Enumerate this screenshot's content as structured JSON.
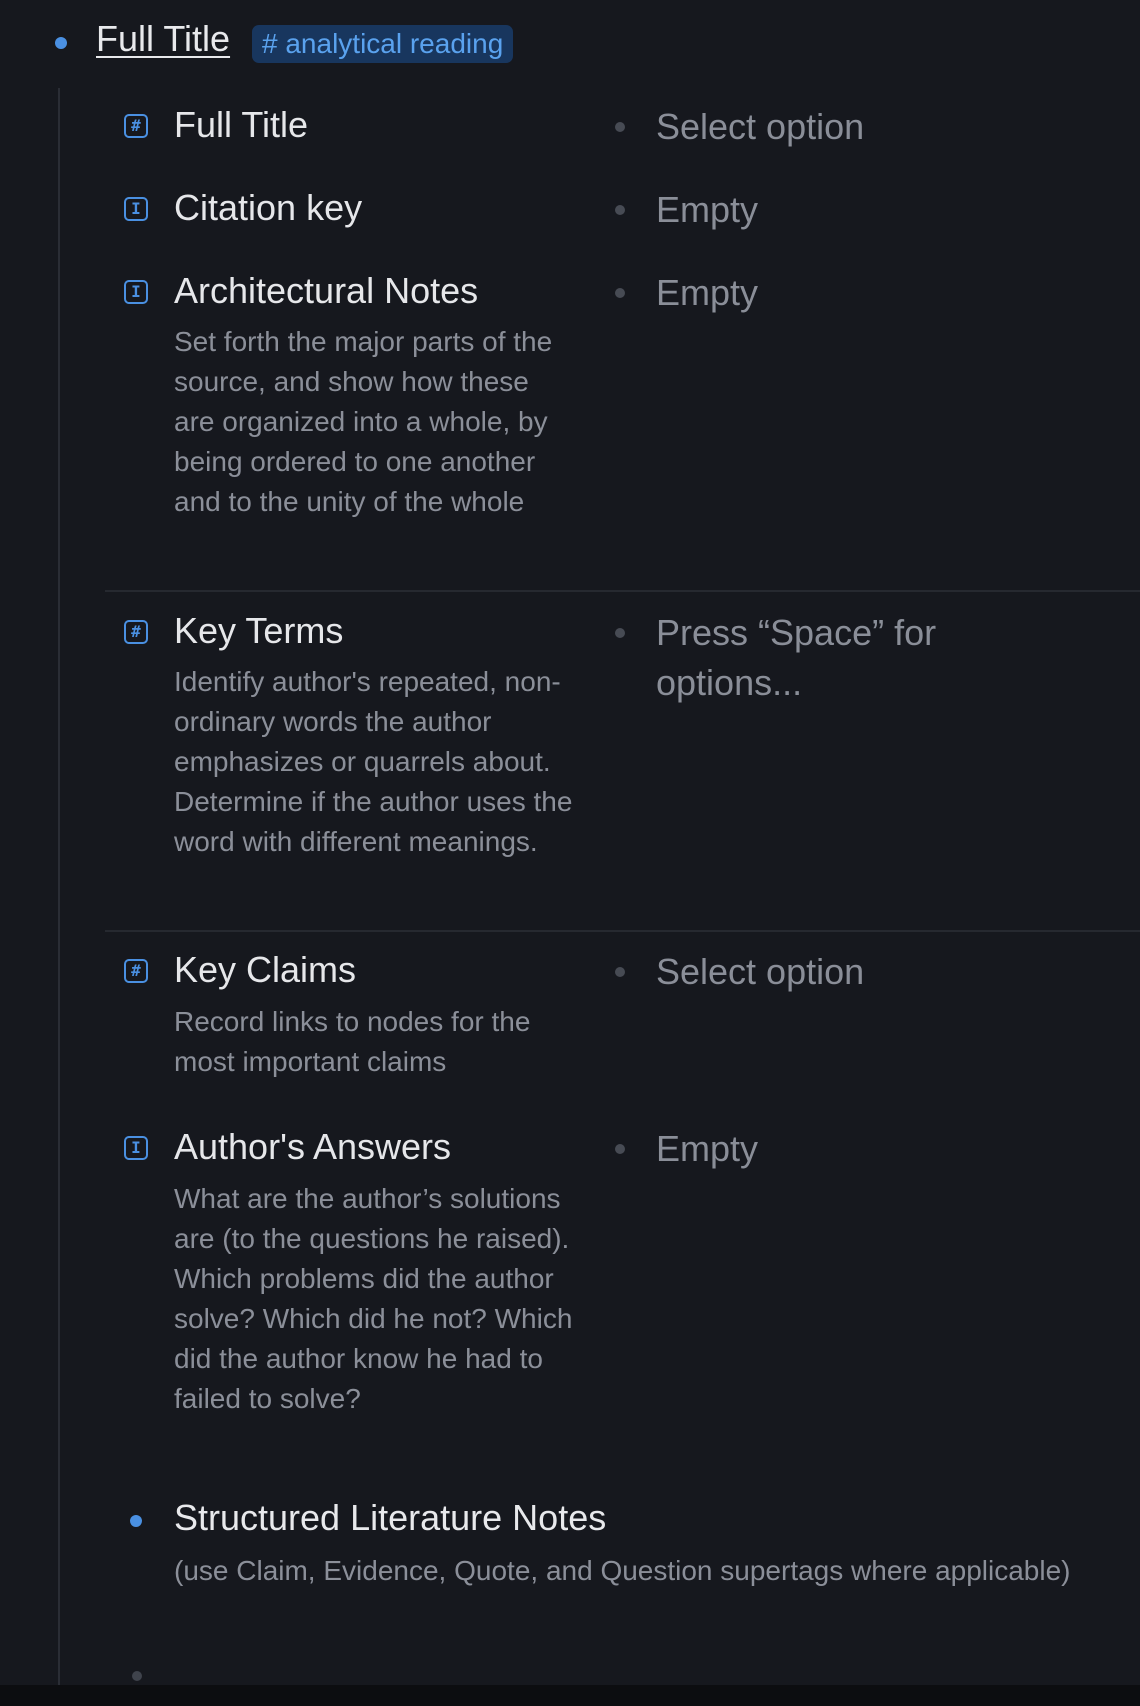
{
  "node": {
    "title": "Full Title",
    "tag": "# analytical reading"
  },
  "fields": [
    {
      "icon": "hash-icon",
      "glyph": "#",
      "name": "Full Title",
      "description": "",
      "value": "Select option"
    },
    {
      "icon": "text-field-icon",
      "glyph": "I",
      "name": "Citation key",
      "description": "",
      "value": "Empty"
    },
    {
      "icon": "text-field-icon",
      "glyph": "I",
      "name": "Architectural Notes",
      "description": "Set forth the major parts of the source, and show how these are organized into a whole, by being ordered to one another and to the unity of the whole",
      "value": "Empty"
    },
    {
      "icon": "hash-icon",
      "glyph": "#",
      "name": "Key Terms",
      "description": "Identify author's repeated, non-ordinary words the author emphasizes or quarrels about. Determine if the author uses the word with different meanings.",
      "value": "Press “Space” for options..."
    },
    {
      "icon": "hash-icon",
      "glyph": "#",
      "name": "Key Claims",
      "description": "Record links to nodes for the most important claims",
      "value": "Select option"
    },
    {
      "icon": "text-field-icon",
      "glyph": "I",
      "name": "Author's Answers",
      "description": "What are the author’s solutions are (to the questions he raised). Which problems did the author solve? Which did he not? Which did the author know he had to failed to solve?",
      "value": "Empty"
    }
  ],
  "child": {
    "title": "Structured Literature Notes",
    "description": "(use Claim, Evidence, Quote, and Question supertags where applicable)"
  },
  "colors": {
    "background": "#16181e",
    "accent": "#4a90e2",
    "tag_background": "#18365e",
    "tag_text": "#5aa2ee",
    "muted_text": "#8b8f99"
  }
}
